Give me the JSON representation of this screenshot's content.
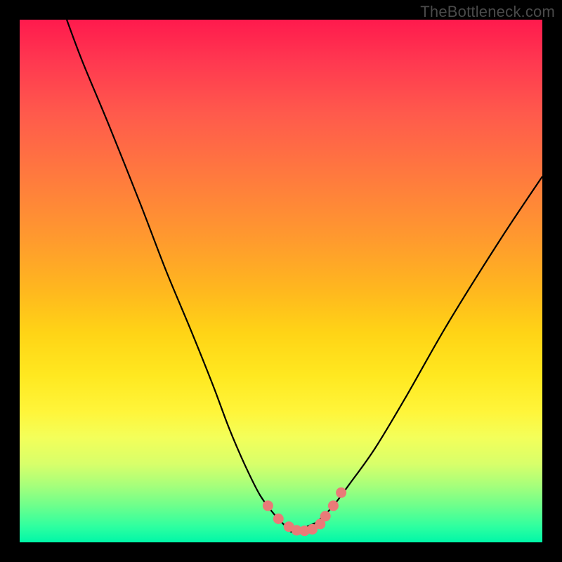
{
  "watermark": "TheBottleneck.com",
  "chart_data": {
    "type": "line",
    "title": "",
    "xlabel": "",
    "ylabel": "",
    "xlim": [
      0,
      100
    ],
    "ylim": [
      0,
      100
    ],
    "series": [
      {
        "name": "bottleneck-curve",
        "x": [
          9,
          12,
          17,
          23,
          28,
          33,
          37,
          40,
          43,
          46,
          49,
          51,
          52,
          54,
          55,
          57,
          60,
          63,
          68,
          74,
          82,
          92,
          100
        ],
        "values": [
          100,
          92,
          80,
          65,
          52,
          40,
          30,
          22,
          15,
          9,
          5,
          3,
          2,
          2,
          3,
          4,
          7,
          11,
          18,
          28,
          42,
          58,
          70
        ]
      }
    ],
    "markers": {
      "name": "highlight-dots",
      "color": "#e97a78",
      "x": [
        47.5,
        49.5,
        51.5,
        53.0,
        54.5,
        56.0,
        57.5,
        58.5,
        60.0,
        61.5
      ],
      "values": [
        7.0,
        4.5,
        3.0,
        2.3,
        2.2,
        2.5,
        3.5,
        5.0,
        7.0,
        9.5
      ]
    },
    "gradient_stops": [
      {
        "pos": 0,
        "color": "#ff1a4d"
      },
      {
        "pos": 30,
        "color": "#ff7a3e"
      },
      {
        "pos": 60,
        "color": "#ffd416"
      },
      {
        "pos": 80,
        "color": "#f3ff5a"
      },
      {
        "pos": 100,
        "color": "#00f7a8"
      }
    ]
  }
}
